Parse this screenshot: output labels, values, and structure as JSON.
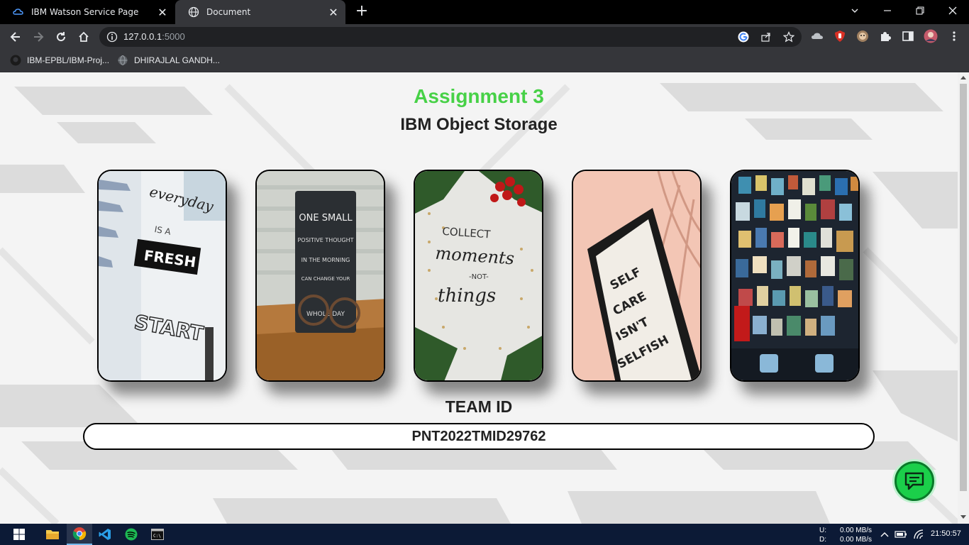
{
  "browser": {
    "tabs": [
      {
        "title": "IBM Watson Service Page",
        "icon": "ibm-cloud-icon"
      },
      {
        "title": "Document",
        "icon": "globe-icon"
      }
    ],
    "url_host": "127.0.0.1",
    "url_port": ":5000",
    "bookmarks": [
      {
        "label": "IBM-EPBL/IBM-Proj...",
        "icon": "github-icon"
      },
      {
        "label": "DHIRAJLAL GANDH...",
        "icon": "globe-icon"
      }
    ]
  },
  "page": {
    "title": "Assignment 3",
    "subtitle": "IBM Object Storage",
    "images": [
      {
        "alt": "everyday is a fresh start",
        "words": [
          "everyday",
          "IS A",
          "FRESH",
          "START"
        ]
      },
      {
        "alt": "one small positive thought",
        "words": [
          "ONE SMALL",
          "POSITIVE THOUGHT",
          "IN THE MORNING",
          "CAN CHANGE YOUR",
          "WHOLE DAY"
        ]
      },
      {
        "alt": "collect moments not things",
        "words": [
          "COLLECT",
          "moments",
          "-NOT-",
          "things"
        ]
      },
      {
        "alt": "self care isn't selfish",
        "words": [
          "SELF",
          "CARE",
          "ISN'T",
          "SELFISH"
        ]
      },
      {
        "alt": "wall of posters"
      }
    ],
    "team_label": "TEAM ID",
    "team_id": "PNT2022TMID29762",
    "colors": {
      "accent": "#47d147",
      "chat": "#1bcf4a"
    }
  },
  "taskbar": {
    "apps": [
      "windows-start-icon",
      "file-explorer-icon",
      "chrome-icon",
      "vscode-icon",
      "spotify-icon",
      "terminal-icon"
    ],
    "upload_label": "U:",
    "upload_value": "0.00 MB/s",
    "download_label": "D:",
    "download_value": "0.00 MB/s",
    "time": "21:50:57"
  }
}
